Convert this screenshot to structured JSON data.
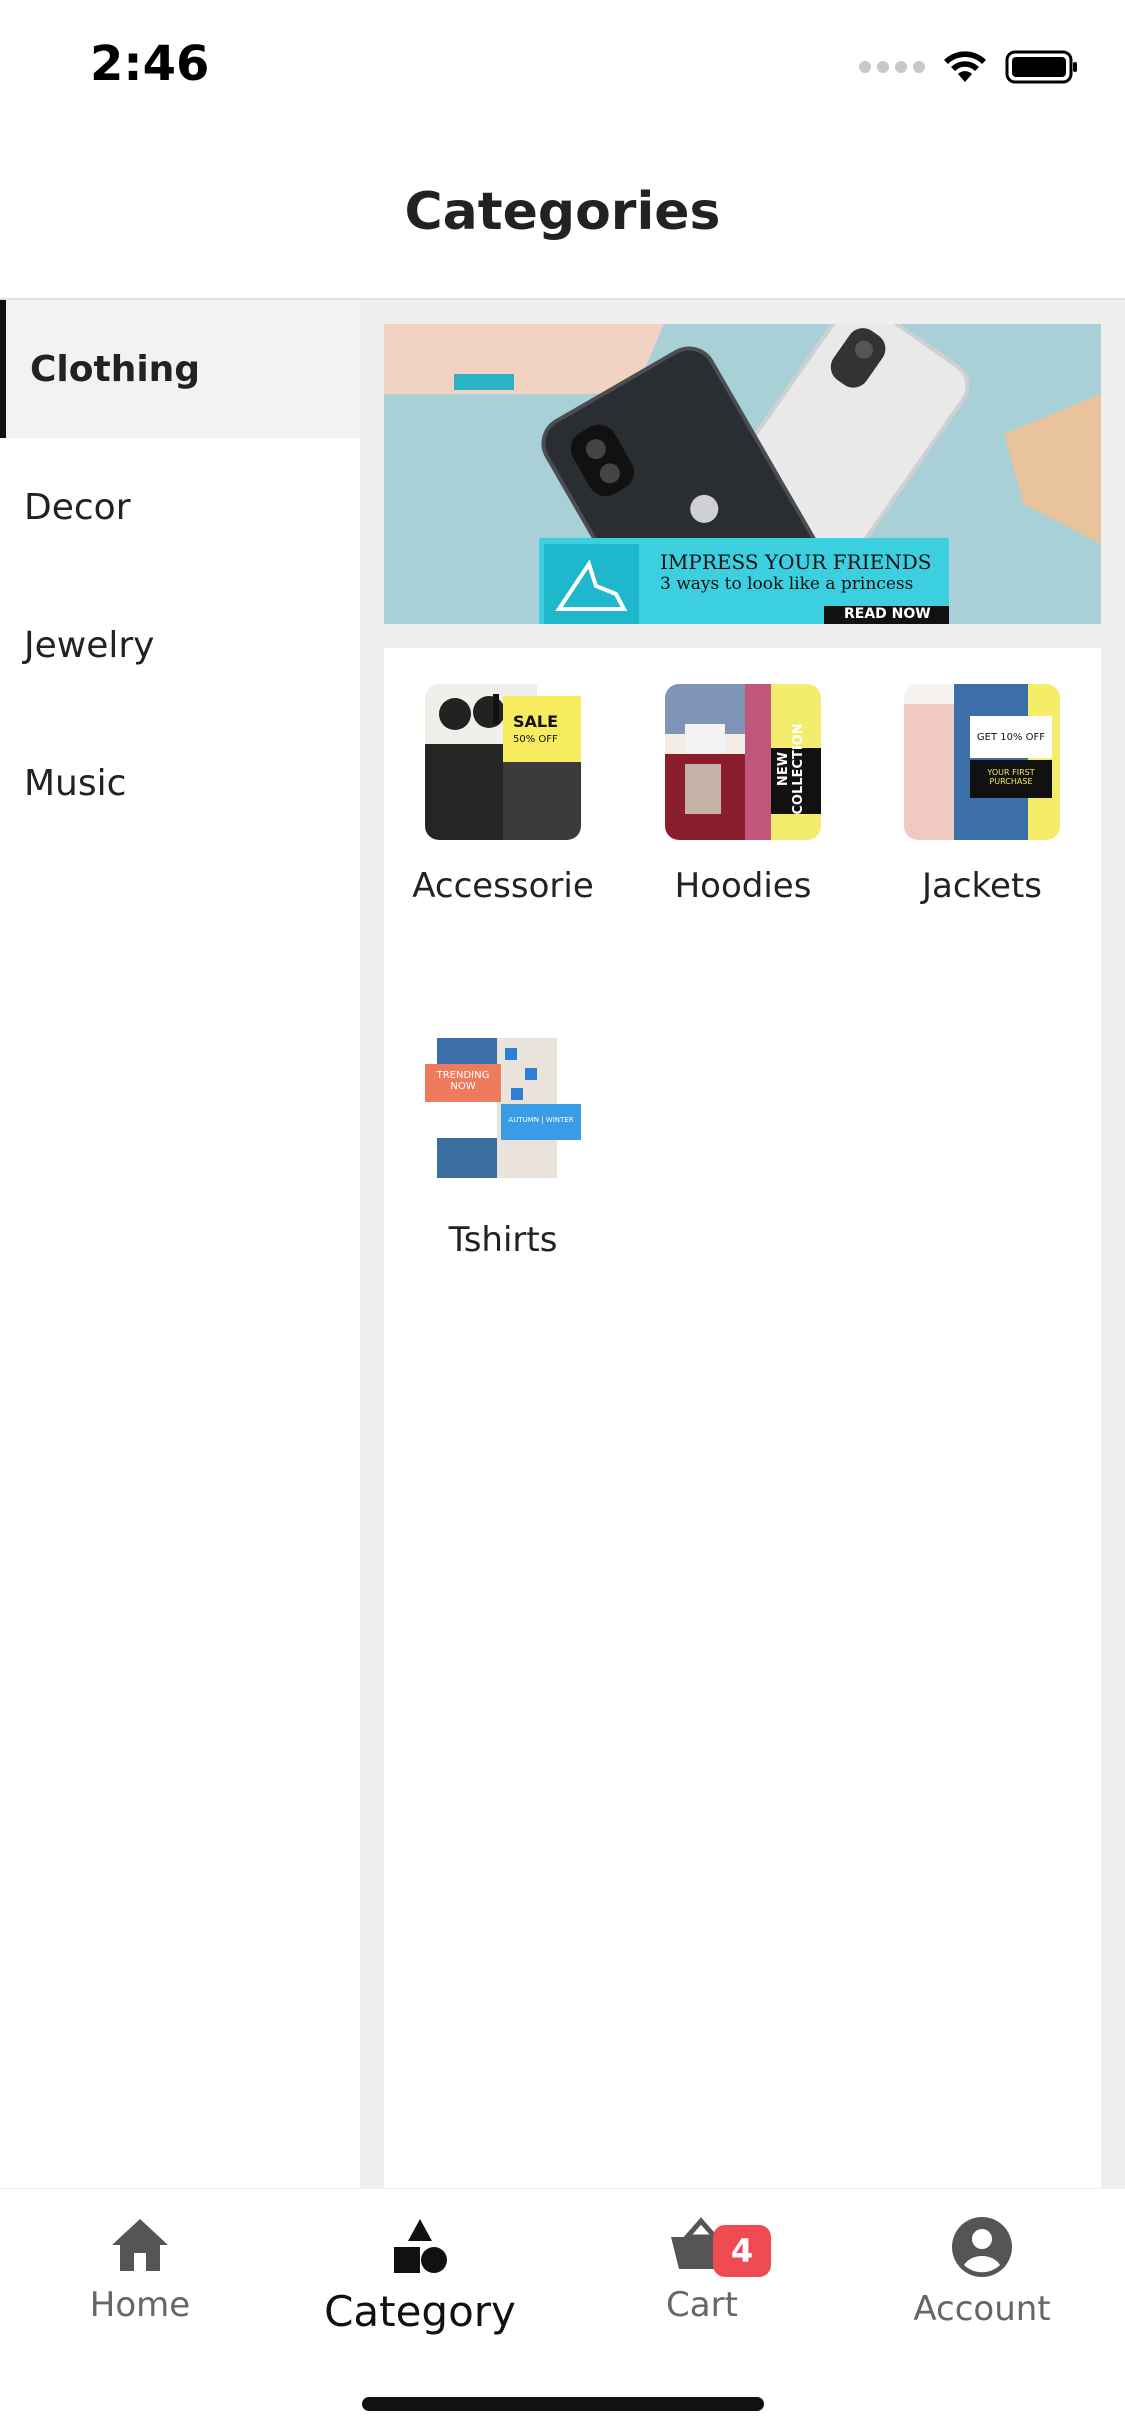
{
  "status": {
    "time": "2:46"
  },
  "header": {
    "title": "Categories"
  },
  "sidebar": {
    "items": [
      {
        "label": "Clothing",
        "active": true
      },
      {
        "label": "Decor"
      },
      {
        "label": "Jewelry"
      },
      {
        "label": "Music"
      }
    ]
  },
  "banner": {
    "headline": "IMPRESS YOUR FRIENDS",
    "subline": "3 ways to look like a princess",
    "cta": "READ NOW"
  },
  "categories": [
    {
      "label": "Accessorie",
      "thumb_text_1": "SALE",
      "thumb_text_2": "50% OFF"
    },
    {
      "label": "Hoodies",
      "thumb_text_1": "NEW COLLECTION"
    },
    {
      "label": "Jackets",
      "thumb_text_1": "GET 10% OFF",
      "thumb_text_2": "YOUR FIRST PURCHASE"
    },
    {
      "label": "Tshirts",
      "thumb_text_1": "TRENDING NOW",
      "thumb_text_2": "AUTUMN | WINTER"
    }
  ],
  "bottom_nav": {
    "items": [
      {
        "label": "Home",
        "icon": "home-icon"
      },
      {
        "label": "Category",
        "icon": "category-icon",
        "active": true
      },
      {
        "label": "Cart",
        "icon": "cart-icon",
        "badge": "4"
      },
      {
        "label": "Account",
        "icon": "account-icon"
      }
    ]
  },
  "colors": {
    "accent": "#f04a52",
    "banner_bg": "#a9cfd7",
    "banner_strip": "#3ccfe0"
  }
}
